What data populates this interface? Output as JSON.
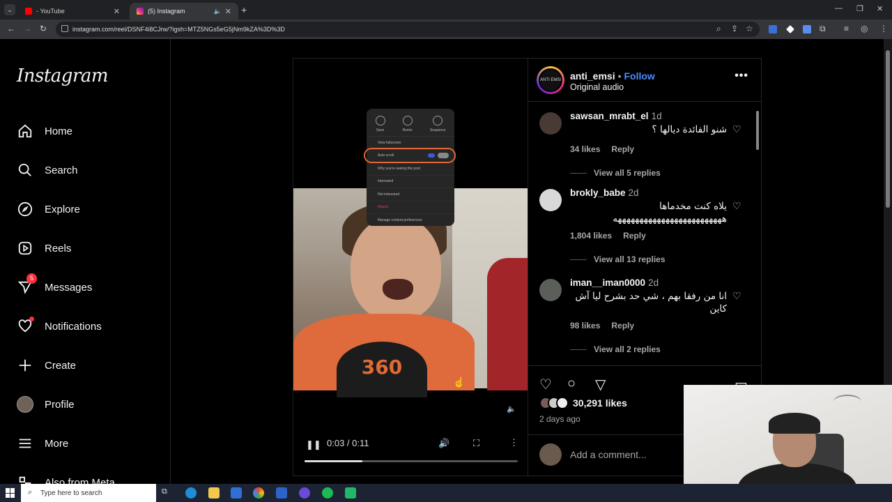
{
  "browser": {
    "tabs": [
      {
        "title": "- YouTube",
        "favicon_color": "#ff0000"
      },
      {
        "title": "(5) Instagram",
        "favicon_color": "#e1306c"
      }
    ],
    "new_tab": "+",
    "url": "instagram.com/reel/DSNF4i8CJrw/?igsh=MTZ5NGs5eG5jNm9kZA%3D%3D"
  },
  "sidebar": {
    "logo": "Instagram",
    "items": [
      {
        "label": "Home",
        "icon": "home-icon"
      },
      {
        "label": "Search",
        "icon": "search-icon"
      },
      {
        "label": "Explore",
        "icon": "compass-icon"
      },
      {
        "label": "Reels",
        "icon": "reels-icon"
      },
      {
        "label": "Messages",
        "icon": "messenger-icon",
        "badge": "5"
      },
      {
        "label": "Notifications",
        "icon": "heart-icon"
      },
      {
        "label": "Create",
        "icon": "plus-icon"
      },
      {
        "label": "Profile",
        "icon": "avatar"
      },
      {
        "label": "More",
        "icon": "hamburger-icon"
      },
      {
        "label": "Also from Meta",
        "icon": "meta-icon"
      }
    ]
  },
  "video": {
    "menu": {
      "top": [
        "Save",
        "Remix",
        "Sequence"
      ],
      "rows": [
        "View fullscreen",
        "Auto scroll",
        "Why you're seeing this post",
        "Interested",
        "Not interested",
        "Report",
        "Manage content preferences"
      ]
    },
    "overlay_logo": "360",
    "time": "0:03 / 0:11",
    "progress": 0.27
  },
  "post": {
    "username": "anti_emsi",
    "follow": "Follow",
    "audio": "Original audio",
    "avatar_text": "ANTI EMSI",
    "comments": [
      {
        "user": "sawsan_mrabt_el",
        "age": "1d",
        "text": "شنو الفائدة ديالها ؟",
        "likes": "34 likes",
        "reply": "Reply",
        "view_replies": "View all 5 replies"
      },
      {
        "user": "brokly_babe",
        "age": "2d",
        "text": "يلاه كنت مخدماها هههههههههههههههههههههههههه",
        "likes": "1,804 likes",
        "reply": "Reply",
        "view_replies": "View all 13 replies"
      },
      {
        "user": "iman__iman0000",
        "age": "2d",
        "text": "انا من رفقا بهم ، شي حد بشرح ليا آش كاين",
        "likes": "98 likes",
        "reply": "Reply",
        "view_replies": "View all 2 replies"
      }
    ],
    "likes_total": "30,291 likes",
    "posted": "2 days ago",
    "add_comment_placeholder": "Add a comment..."
  },
  "taskbar": {
    "search_placeholder": "Type here to search"
  },
  "colors": {
    "accent_blue": "#4a8dff",
    "notification_red": "#ff3040",
    "background": "#000000"
  }
}
